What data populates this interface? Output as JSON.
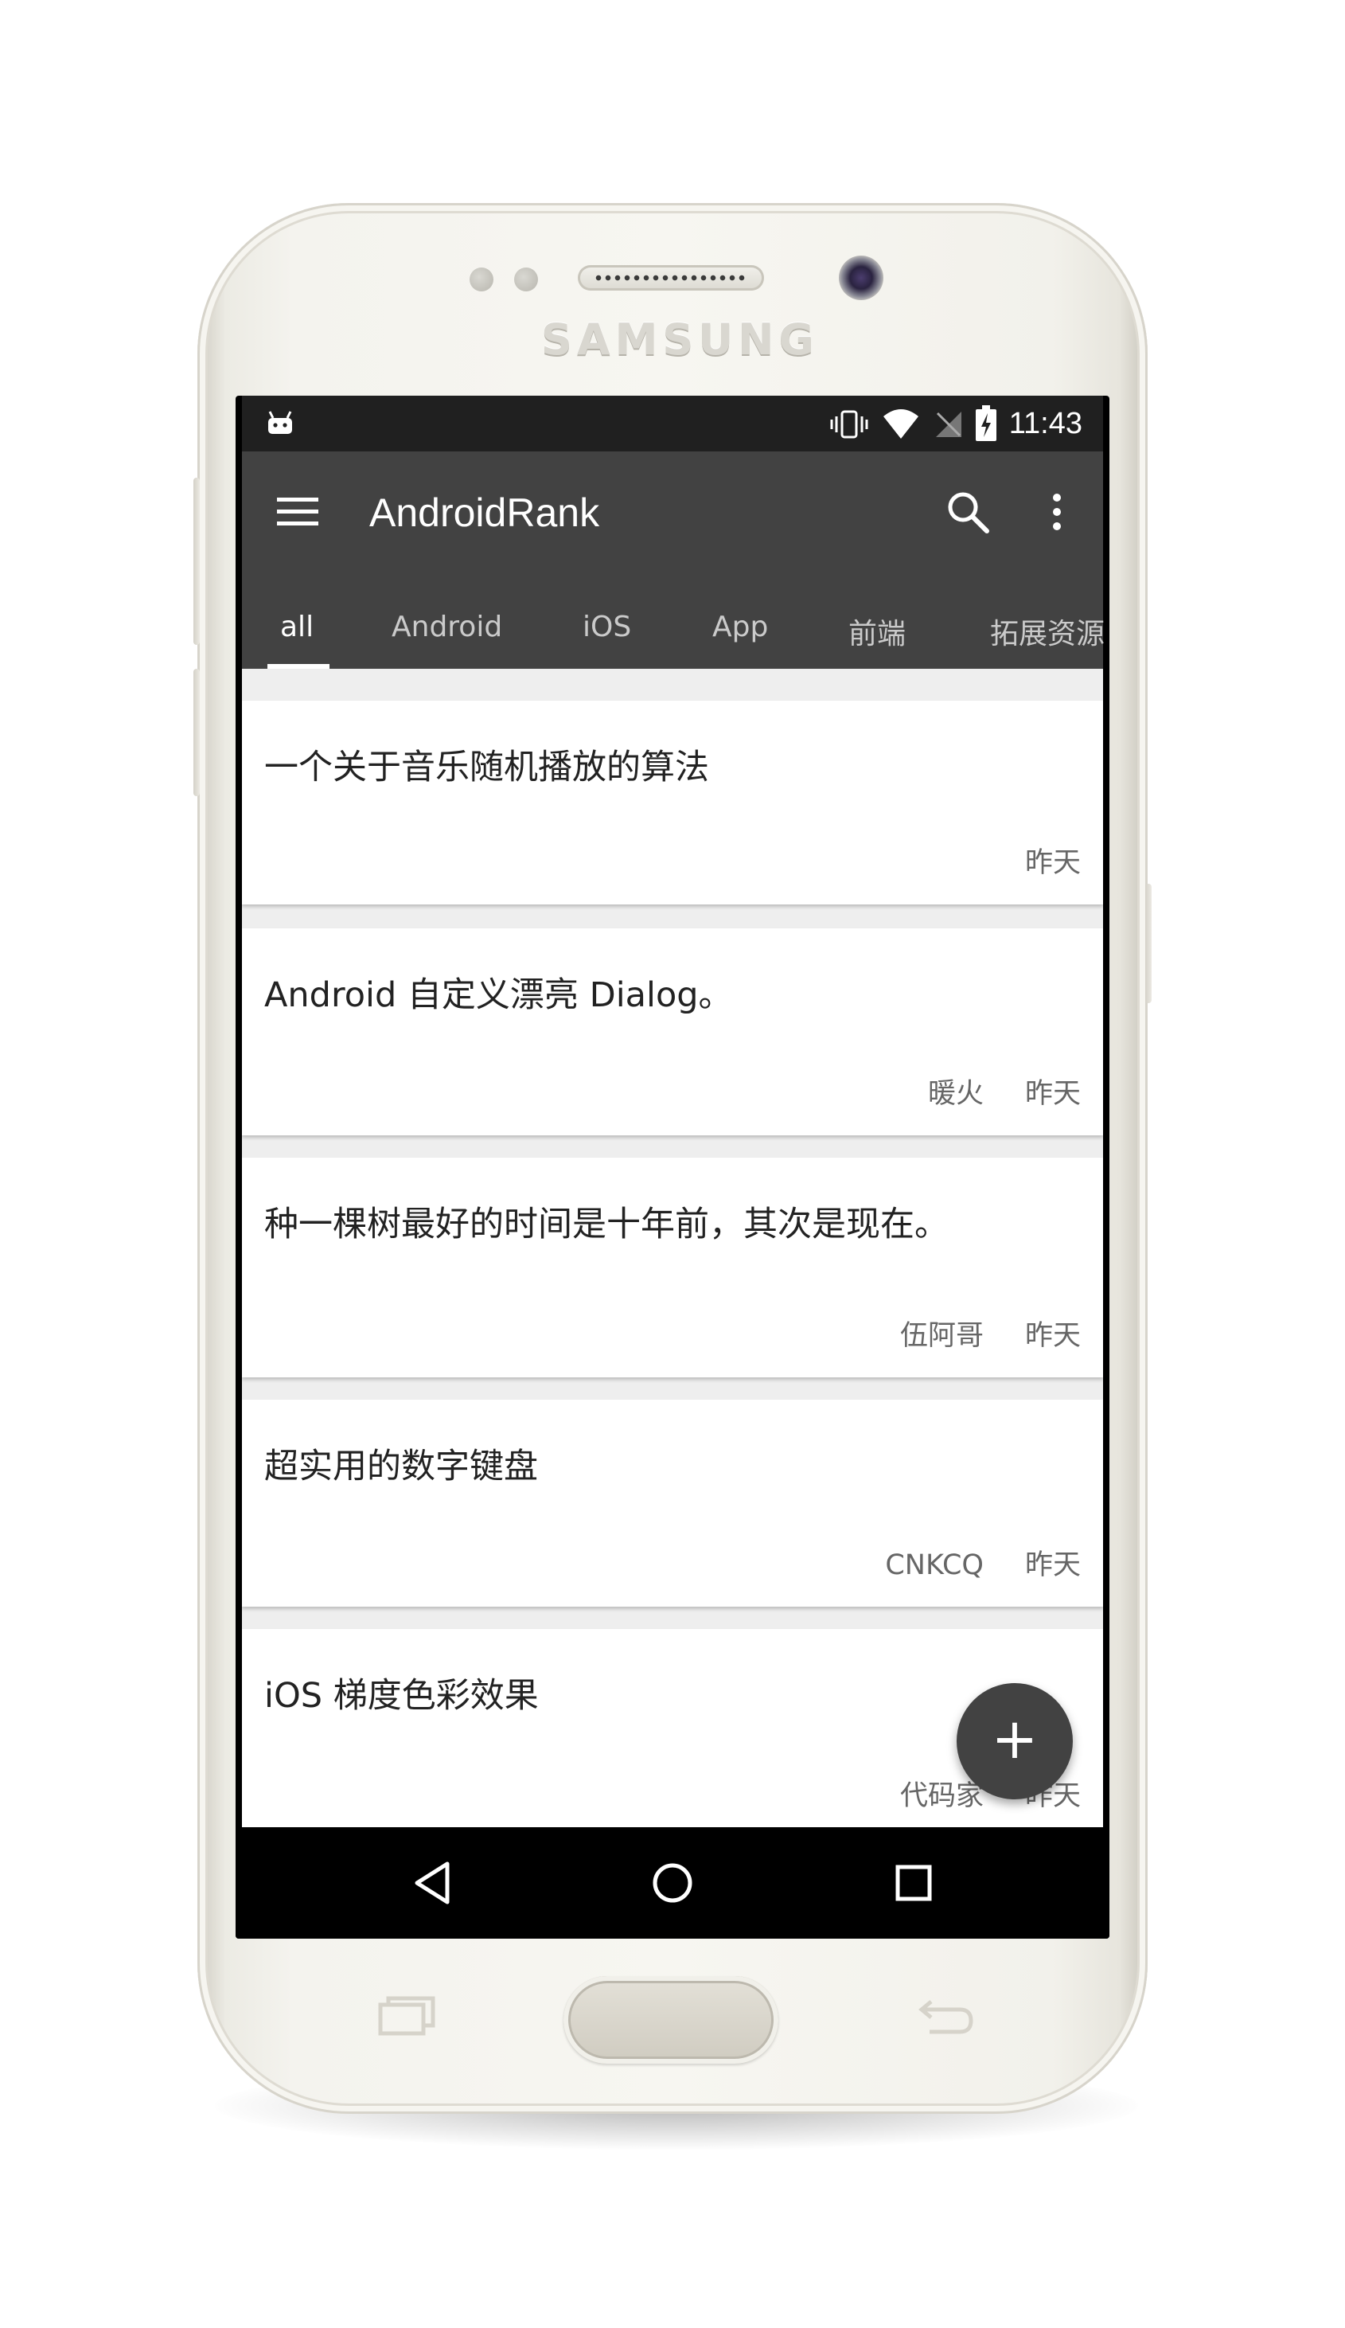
{
  "device": {
    "brand": "SAMSUNG"
  },
  "status_bar": {
    "time": "11:43"
  },
  "toolbar": {
    "title": "AndroidRank"
  },
  "tabs": [
    {
      "label": "all",
      "active": true
    },
    {
      "label": "Android"
    },
    {
      "label": "iOS"
    },
    {
      "label": "App"
    },
    {
      "label": "前端"
    },
    {
      "label": "拓展资源"
    }
  ],
  "articles": [
    {
      "title": "一个关于音乐随机播放的算法",
      "author": "",
      "date": "昨天"
    },
    {
      "title": "Android 自定义漂亮 Dialog。",
      "author": "暖火",
      "date": "昨天"
    },
    {
      "title": "种一棵树最好的时间是十年前，其次是现在。",
      "author": "伍阿哥",
      "date": "昨天"
    },
    {
      "title": "超实用的数字键盘",
      "author": "CNKCQ",
      "date": "昨天"
    },
    {
      "title": "iOS 梯度色彩效果",
      "author": "代码家",
      "date": "昨天"
    }
  ],
  "fab": {
    "label": "+"
  },
  "colors": {
    "toolbar": "#424242",
    "status_bar": "#202020",
    "background": "#eeeeee",
    "fab": "#424242"
  }
}
